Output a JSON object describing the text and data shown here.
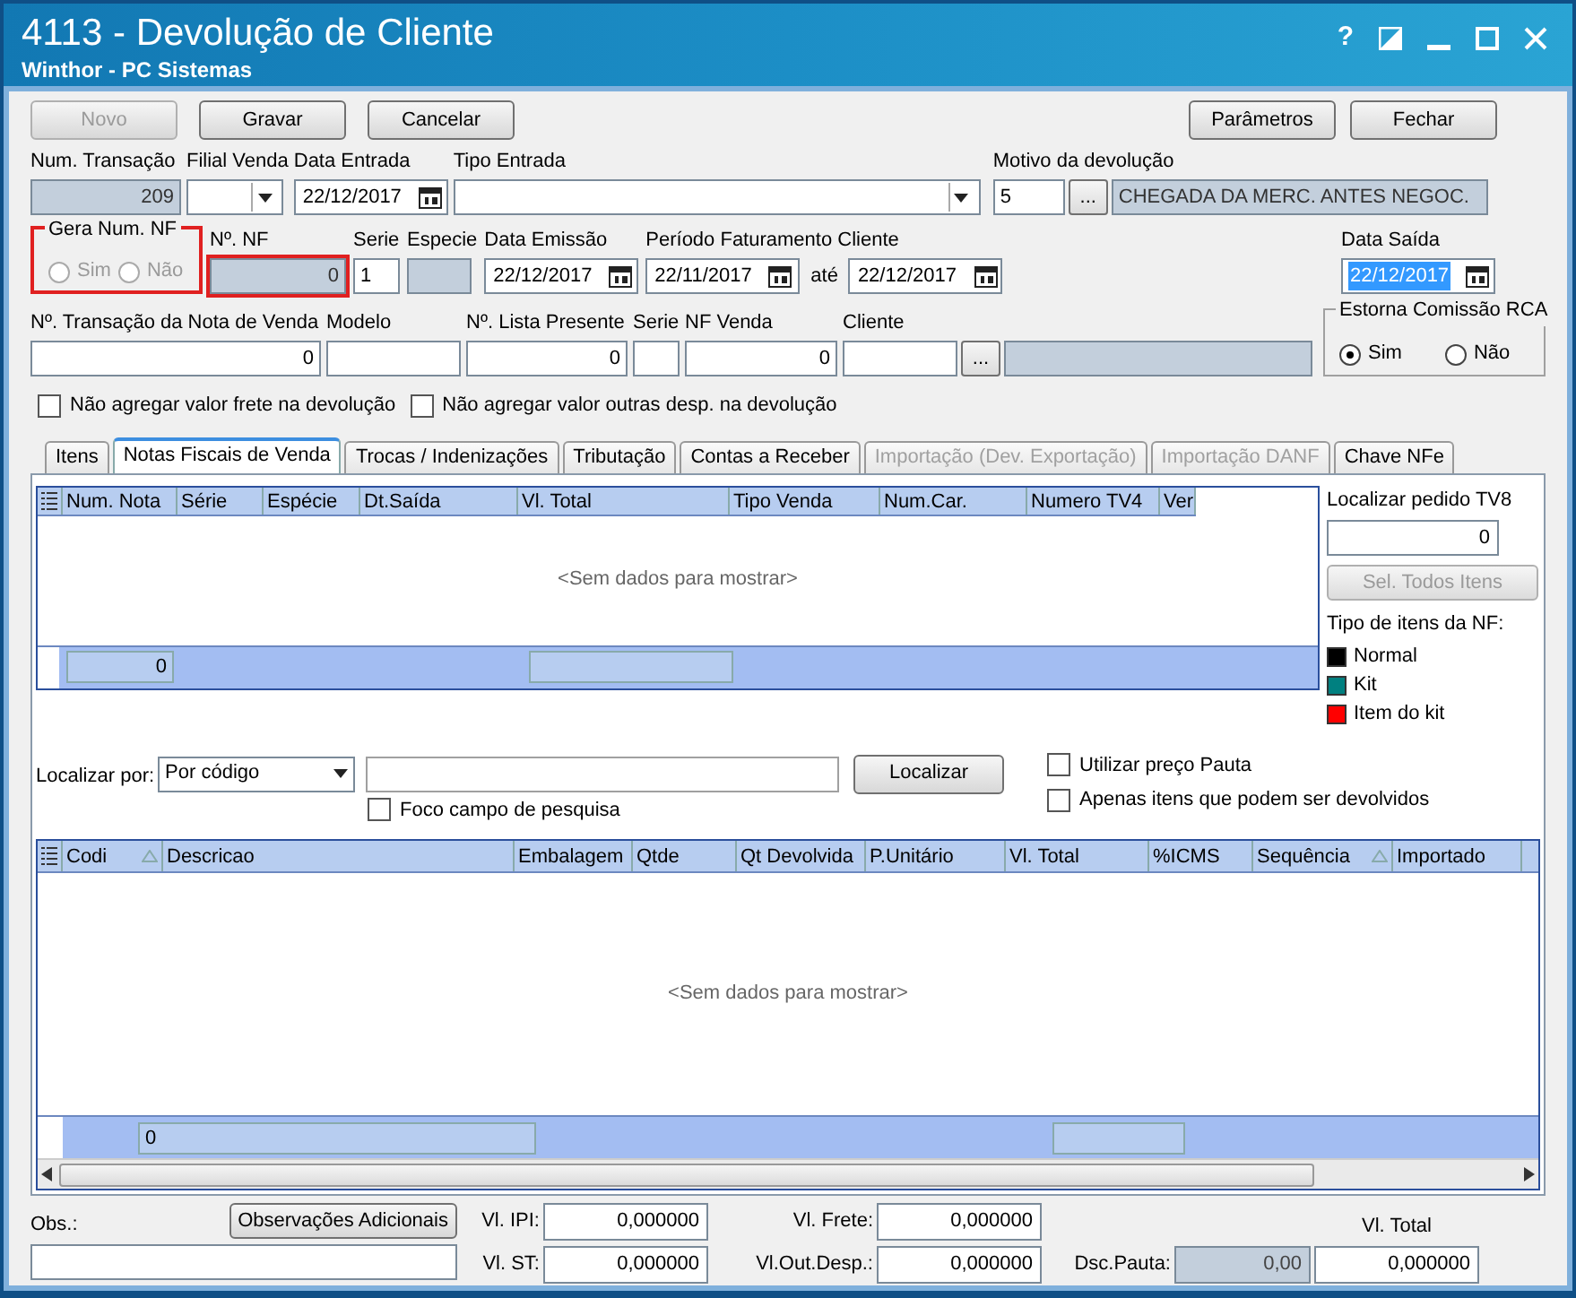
{
  "window": {
    "title": "4113 - Devolução de Cliente",
    "subtitle": "Winthor - PC Sistemas",
    "help": "?"
  },
  "toolbar": {
    "left": [
      {
        "label": "Novo",
        "disabled": true
      },
      {
        "label": "Gravar",
        "disabled": false
      },
      {
        "label": "Cancelar",
        "disabled": false
      }
    ],
    "right": [
      {
        "label": "Parâmetros",
        "disabled": false
      },
      {
        "label": "Fechar",
        "disabled": false
      }
    ]
  },
  "row1": [
    {
      "label": "Num. Transação",
      "widgets": [
        {
          "kind": "readonly",
          "value": "209"
        }
      ]
    },
    {
      "label": "Filial Venda",
      "widgets": [
        {
          "kind": "select"
        }
      ]
    },
    {
      "label": "Data Entrada",
      "widgets": [
        {
          "kind": "date",
          "value": "22/12/2017"
        }
      ]
    },
    {
      "label": "Tipo Entrada",
      "widgets": [
        {
          "kind": "select"
        }
      ]
    },
    {
      "label": "Motivo da devolução",
      "widgets": [
        {
          "kind": "text",
          "value": "5"
        },
        {
          "kind": "lookup",
          "value": "..."
        },
        {
          "kind": "desc",
          "value": "CHEGADA DA MERC. ANTES NEGOC."
        }
      ]
    }
  ],
  "gera_num_nf": {
    "label": "Gera Num. NF",
    "highlighted": true,
    "options": [
      {
        "label": "Sim",
        "selected": false,
        "disabled": true
      },
      {
        "label": "Não",
        "selected": false,
        "disabled": true
      }
    ]
  },
  "row2": [
    {
      "label": "Nº. NF",
      "highlighted": true,
      "widgets": [
        {
          "kind": "readonly",
          "value": "0"
        }
      ]
    },
    {
      "label": "Serie",
      "widgets": [
        {
          "kind": "text",
          "value": "1"
        }
      ]
    },
    {
      "label": "Especie",
      "widgets": [
        {
          "kind": "readonly"
        }
      ]
    },
    {
      "label": "Data Emissão",
      "widgets": [
        {
          "kind": "date",
          "value": "22/12/2017"
        }
      ]
    },
    {
      "label": "Período Faturamento Cliente",
      "widgets": [
        {
          "kind": "date",
          "value": "22/11/2017"
        },
        {
          "kind": "caption",
          "value": "até"
        },
        {
          "kind": "date",
          "value": "22/12/2017"
        }
      ]
    },
    {
      "label": "Data Saída",
      "widgets": [
        {
          "kind": "date",
          "value": "22/12/2017",
          "selected": true
        }
      ]
    }
  ],
  "row3": [
    {
      "label": "Nº. Transação da Nota de  Venda",
      "widgets": [
        {
          "kind": "number",
          "value": "0"
        }
      ]
    },
    {
      "label": "Modelo",
      "widgets": [
        {
          "kind": "text"
        }
      ]
    },
    {
      "label": "Nº. Lista Presente",
      "widgets": [
        {
          "kind": "number",
          "value": "0"
        }
      ]
    },
    {
      "label": "Serie",
      "widgets": [
        {
          "kind": "text"
        }
      ]
    },
    {
      "label": "NF Venda",
      "widgets": [
        {
          "kind": "number",
          "value": "0"
        }
      ]
    },
    {
      "label": "Cliente",
      "widgets": [
        {
          "kind": "text"
        },
        {
          "kind": "lookup",
          "value": "..."
        },
        {
          "kind": "desc"
        }
      ]
    }
  ],
  "estorna": {
    "label": "Estorna Comissão RCA",
    "options": [
      {
        "label": "Sim",
        "selected": true,
        "disabled": false
      },
      {
        "label": "Não",
        "selected": false,
        "disabled": false
      }
    ]
  },
  "options": [
    {
      "label": "Não agregar valor frete  na devolução",
      "checked": false
    },
    {
      "label": "Não agregar valor outras desp. na devolução",
      "checked": false
    }
  ],
  "tabs": [
    {
      "label": "Itens",
      "selected": false,
      "disabled": false
    },
    {
      "label": "Notas Fiscais de Venda",
      "selected": true,
      "disabled": false
    },
    {
      "label": "Trocas / Indenizações",
      "selected": false,
      "disabled": false
    },
    {
      "label": "Tributação",
      "selected": false,
      "disabled": false
    },
    {
      "label": "Contas a Receber",
      "selected": false,
      "disabled": false
    },
    {
      "label": "Importação (Dev. Exportação)",
      "selected": false,
      "disabled": true
    },
    {
      "label": "Importação DANF",
      "selected": false,
      "disabled": true
    },
    {
      "label": "Chave NFe",
      "selected": false,
      "disabled": false
    }
  ],
  "notes_grid": {
    "columns": [
      "Num. Nota",
      "Série",
      "Espécie",
      "Dt.Saída",
      "Vl. Total",
      "Tipo Venda",
      "Num.Car.",
      "Numero TV4",
      "Ver"
    ],
    "empty_text": "<Sem dados para mostrar>",
    "footer": [
      "0"
    ]
  },
  "side": {
    "search_label": "Localizar pedido TV8",
    "search_value": "0",
    "select_all": {
      "label": "Sel. Todos Itens",
      "disabled": true
    },
    "legend_title": "Tipo de itens da NF:",
    "legend": [
      {
        "label": "Normal",
        "color": "#000000"
      },
      {
        "label": "Kit",
        "color": "#008080"
      },
      {
        "label": "Item do kit",
        "color": "#ff0000"
      }
    ]
  },
  "search": {
    "label": "Localizar por:",
    "mode": "Por código",
    "button": "Localizar",
    "focus": {
      "label": "Foco campo de pesquisa",
      "checked": false
    },
    "checks": [
      {
        "label": "Utilizar preço Pauta",
        "checked": false
      },
      {
        "label": "Apenas itens que podem ser devolvidos",
        "checked": false
      }
    ]
  },
  "items_grid": {
    "columns": [
      {
        "label": "Codi",
        "sorted": true
      },
      {
        "label": "Descricao",
        "sorted": false
      },
      {
        "label": "Embalagem",
        "sorted": false
      },
      {
        "label": "Qtde",
        "sorted": false
      },
      {
        "label": "Qt Devolvida",
        "sorted": false
      },
      {
        "label": "P.Unitário",
        "sorted": false
      },
      {
        "label": "Vl. Total",
        "sorted": false
      },
      {
        "label": "%ICMS",
        "sorted": false
      },
      {
        "label": "Sequência",
        "sorted": true
      },
      {
        "label": "Importado",
        "sorted": false
      }
    ],
    "empty_text": "<Sem dados para mostrar>",
    "footer": [
      "0"
    ]
  },
  "footer": {
    "obs_label": "Obs.:",
    "obs_button": "Observações Adicionais",
    "ipi": {
      "label": "Vl. IPI:",
      "value": "0,000000"
    },
    "st": {
      "label": "Vl. ST:",
      "value": "0,000000"
    },
    "frete": {
      "label": "Vl. Frete:",
      "value": "0,000000"
    },
    "out_desp": {
      "label": "Vl.Out.Desp.:",
      "value": "0,000000"
    },
    "dsc_pauta": {
      "label": "Dsc.Pauta:",
      "value": "0,00"
    },
    "total": {
      "label": "Vl. Total",
      "value": "0,000000"
    }
  }
}
